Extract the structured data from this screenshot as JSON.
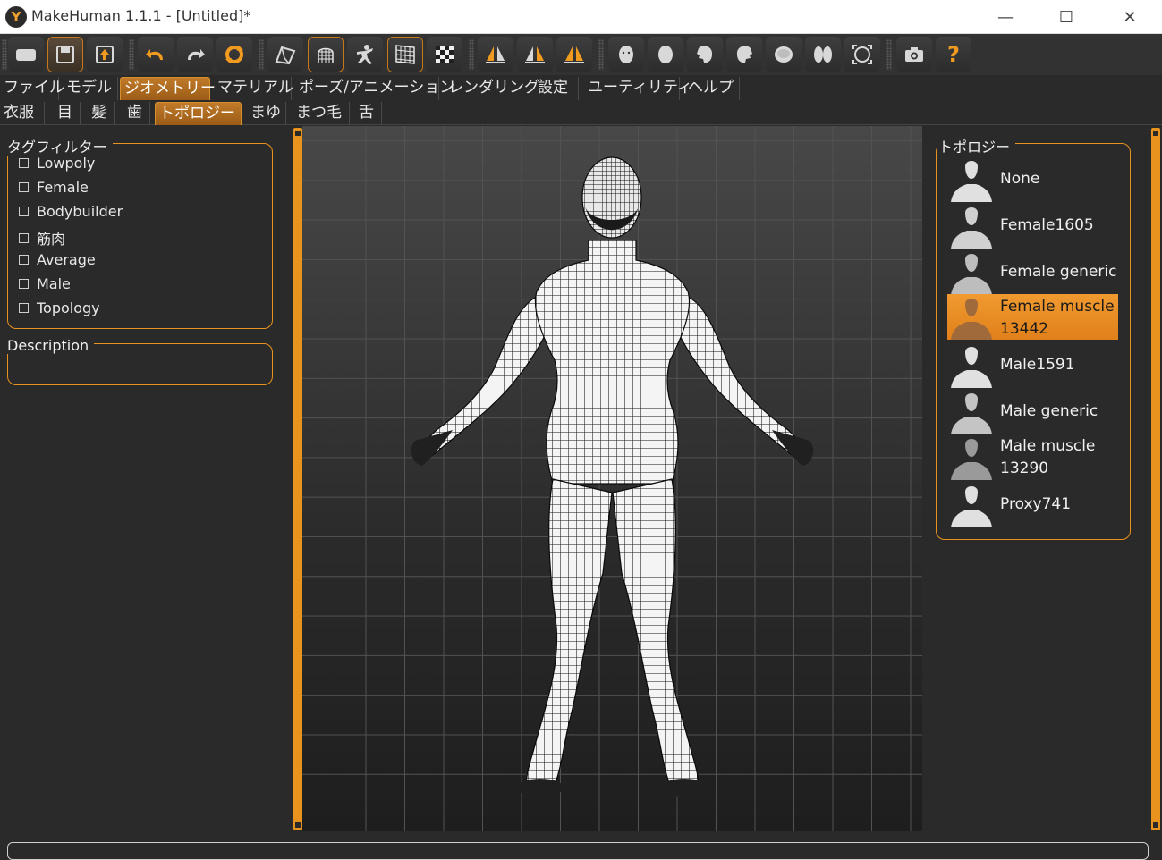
{
  "window": {
    "title": "MakeHuman 1.1.1 - [Untitled]*",
    "minimize_glyph": "—",
    "maximize_glyph": "☐",
    "close_glyph": "✕"
  },
  "toolbar": {
    "icons": [
      "open-icon",
      "save-icon",
      "export-icon",
      "undo-icon",
      "redo-icon",
      "reset-icon",
      "smooth-icon",
      "wireframe-icon",
      "pose-icon",
      "grid-icon",
      "background-icon",
      "symmetry-right-icon",
      "symmetry-left-icon",
      "symmetry-icon",
      "front-view-icon",
      "back-view-icon",
      "left-view-icon",
      "right-view-icon",
      "top-view-icon",
      "bottom-view-icon",
      "reset-camera-icon",
      "screenshot-icon",
      "help-icon"
    ],
    "help_glyph": "?"
  },
  "menu": {
    "tabs": [
      "ファイル",
      "モデル",
      "ジオメトリー",
      "マテリアル",
      "ポーズ/アニメーション",
      "レンダリング",
      "設定",
      "ユーティリティ",
      "ヘルプ"
    ],
    "selected": "ジオメトリー"
  },
  "submenu": {
    "tabs": [
      "衣服",
      "目",
      "髪",
      "歯",
      "トポロジー",
      "まゆ",
      "まつ毛",
      "舌"
    ],
    "selected": "トポロジー"
  },
  "tag_filter": {
    "title": "タグフィルター",
    "items": [
      "Lowpoly",
      "Female",
      "Bodybuilder",
      "筋肉",
      "Average",
      "Male",
      "Topology"
    ]
  },
  "description": {
    "title": "Description"
  },
  "topology": {
    "title": "トポロジー",
    "items": [
      {
        "line1": "None",
        "line2": ""
      },
      {
        "line1": "Female1605",
        "line2": ""
      },
      {
        "line1": "Female generic",
        "line2": ""
      },
      {
        "line1": "Female muscle",
        "line2": "13442"
      },
      {
        "line1": "Male1591",
        "line2": ""
      },
      {
        "line1": "Male generic",
        "line2": ""
      },
      {
        "line1": "Male muscle",
        "line2": "13290"
      },
      {
        "line1": "Proxy741",
        "line2": ""
      }
    ],
    "selected": "Female muscle 13442"
  },
  "colors": {
    "accent": "#e8931e",
    "panel_bg": "#2a2a2a"
  }
}
